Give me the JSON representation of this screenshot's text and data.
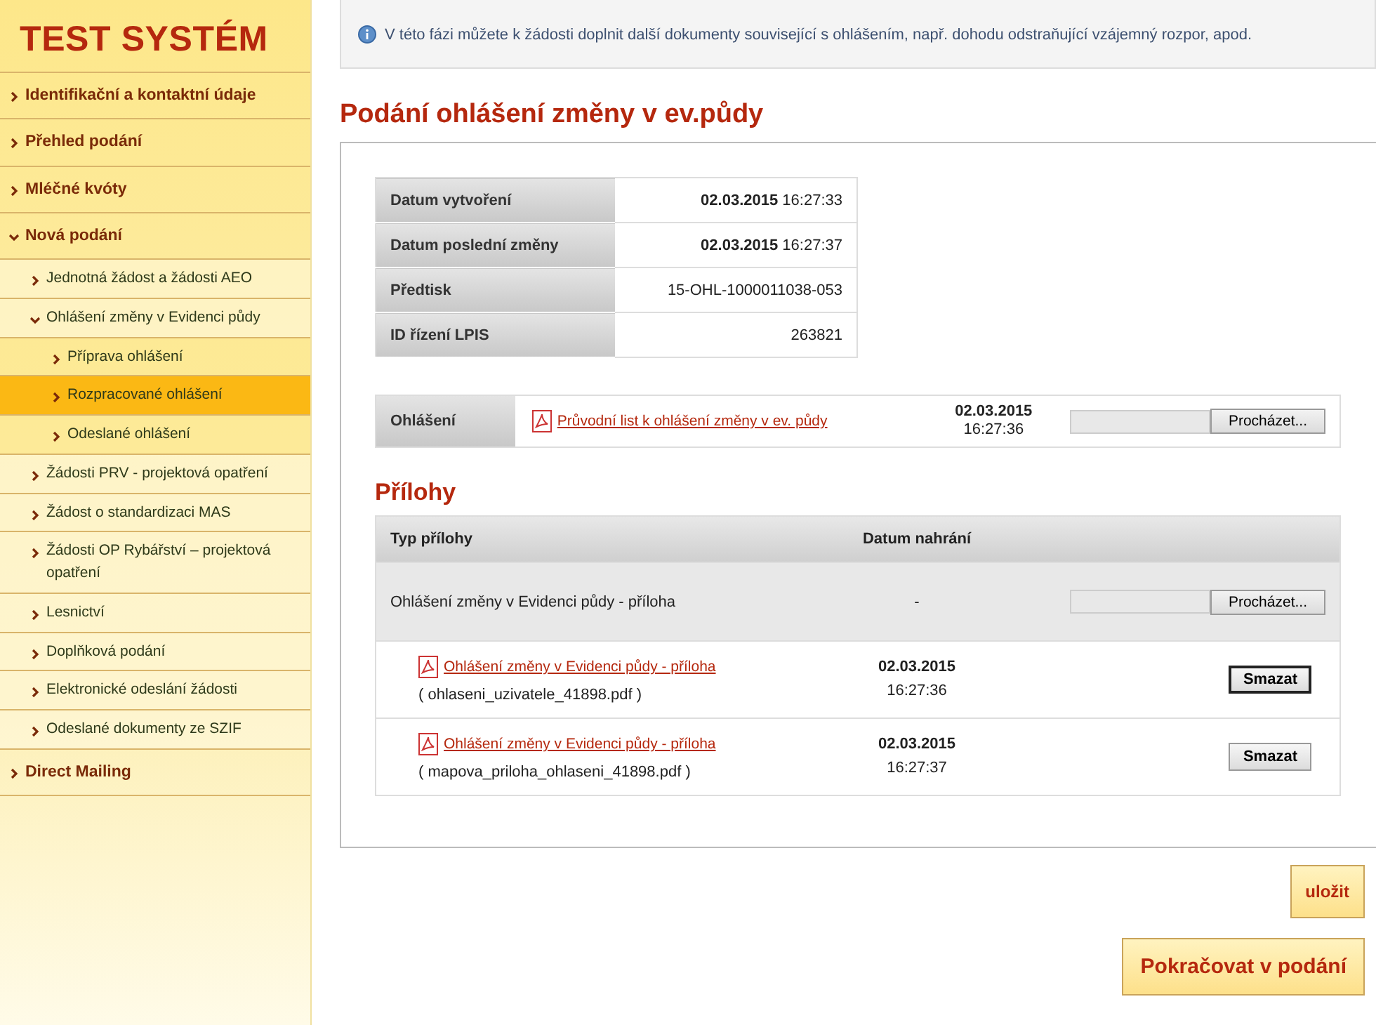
{
  "brand": "TEST SYSTÉM",
  "sidebar": {
    "items": [
      {
        "label": "Identifikační a kontaktní údaje",
        "expanded": false,
        "selected": false
      },
      {
        "label": "Přehled podání",
        "expanded": false,
        "selected": false
      },
      {
        "label": "Mléčné kvóty",
        "expanded": false,
        "selected": false
      },
      {
        "label": "Nová podání",
        "expanded": true,
        "selected": false,
        "children": [
          {
            "label": "Jednotná žádost a žádosti AEO",
            "expanded": false,
            "selected": false
          },
          {
            "label": "Ohlášení změny v Evidenci půdy",
            "expanded": true,
            "selected": false,
            "children": [
              {
                "label": "Příprava ohlášení",
                "expanded": false,
                "selected": false
              },
              {
                "label": "Rozpracované ohlášení",
                "expanded": false,
                "selected": true
              },
              {
                "label": "Odeslané ohlášení",
                "expanded": false,
                "selected": false
              }
            ]
          },
          {
            "label": "Žádosti PRV - projektová opatření",
            "expanded": false,
            "selected": false
          },
          {
            "label": "Žádost o standardizaci MAS",
            "expanded": false,
            "selected": false
          },
          {
            "label": "Žádosti OP Rybářství – projektová opatření",
            "expanded": false,
            "selected": false
          },
          {
            "label": "Lesnictví",
            "expanded": false,
            "selected": false
          },
          {
            "label": "Doplňková podání",
            "expanded": false,
            "selected": false
          },
          {
            "label": "Elektronické odeslání žádosti",
            "expanded": false,
            "selected": false
          },
          {
            "label": "Odeslané dokumenty ze SZIF",
            "expanded": false,
            "selected": false
          }
        ]
      },
      {
        "label": "Direct Mailing",
        "expanded": false,
        "selected": false
      }
    ]
  },
  "info": "V této fázi můžete k žádosti doplnit další dokumenty související s ohlášením, např. dohodu odstraňující vzájemný rozpor, apod.",
  "title": "Podání ohlášení změny v ev.půdy",
  "details": [
    {
      "label": "Datum vytvoření",
      "date": "02.03.2015",
      "time": "16:27:33"
    },
    {
      "label": "Datum poslední změny",
      "date": "02.03.2015",
      "time": "16:27:37"
    },
    {
      "label": "Předtisk",
      "value": "15-OHL-1000011038-053"
    },
    {
      "label": "ID řízení LPIS",
      "value": "263821"
    }
  ],
  "report": {
    "label": "Ohlášení",
    "link": "Průvodní list k ohlášení změny v ev. půdy",
    "date": "02.03.2015",
    "time": "16:27:36",
    "browse": "Procházet..."
  },
  "attachments": {
    "heading": "Přílohy",
    "columns": [
      "Typ přílohy",
      "Datum nahrání"
    ],
    "rows": [
      {
        "kind": "upload",
        "type": "Ohlášení změny v Evidenci půdy - příloha",
        "date": "-",
        "browse": "Procházet..."
      },
      {
        "kind": "file",
        "link": "Ohlášení změny v Evidenci půdy - příloha",
        "file": "( ohlaseni_uzivatele_41898.pdf )",
        "date": "02.03.2015",
        "time": "16:27:36",
        "delete": "Smazat",
        "focused": true
      },
      {
        "kind": "file",
        "link": "Ohlášení změny v Evidenci půdy - příloha",
        "file": "( mapova_priloha_ohlaseni_41898.pdf )",
        "date": "02.03.2015",
        "time": "16:27:37",
        "delete": "Smazat",
        "focused": false
      }
    ]
  },
  "buttons": {
    "save": "uložit",
    "continue": "Pokračovat v podání"
  }
}
